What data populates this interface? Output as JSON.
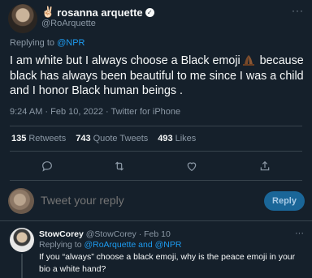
{
  "author": {
    "emoji": "✌🏻",
    "name": "rosanna arquette",
    "verified_mark": "✓",
    "handle": "@RoArquette",
    "more": "···"
  },
  "tweet": {
    "replying_label": "Replying to",
    "replying_handle": "@NPR",
    "text": "I am white but I always choose a Black emoji",
    "text_rest": " because black has always been beautiful to me since I was a child and I honor Black human beings .",
    "time": "9:24 AM · Feb 10, 2022 · Twitter for iPhone"
  },
  "stats": {
    "retweets_count": "135",
    "retweets_label": "Retweets",
    "quotes_count": "743",
    "quotes_label": "Quote Tweets",
    "likes_count": "493",
    "likes_label": "Likes"
  },
  "actions": {
    "icons": [
      "reply-icon",
      "retweet-icon",
      "like-icon",
      "share-icon"
    ]
  },
  "compose": {
    "placeholder": "Tweet your reply",
    "button": "Reply"
  },
  "reply": {
    "name": "StowCorey",
    "handle": "@StowCorey",
    "sep": "·",
    "date": "Feb 10",
    "replying_label": "Replying to",
    "replying_handles": "@RoArquette and @NPR",
    "text": "If you “always” choose a black emoji, why is the peace emoji in your bio a white hand?",
    "more": "···"
  },
  "colors": {
    "background": "#15202b",
    "text": "#f7f9f9",
    "muted": "#8b98a5",
    "accent": "#1d9bf0",
    "divider": "#38444d"
  }
}
